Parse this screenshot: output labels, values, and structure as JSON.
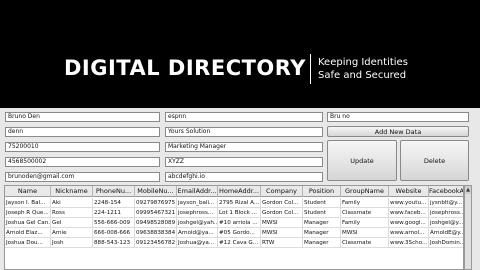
{
  "header": {
    "title": "DIGITAL DIRECTORY",
    "tagline_line1": "Keeping Identities",
    "tagline_line2": "Safe and Secured"
  },
  "form": {
    "name": "Bruno Den",
    "nickname": "denn",
    "phone": "75200010",
    "mobile": "4568500002",
    "email": "brunoden@gmail.com",
    "home_address": "espnn",
    "company": "Yours Solution",
    "position": "Marketing Manager",
    "group": "XYZZ",
    "website": "abcdefghi.io",
    "facebook": "Bru no"
  },
  "buttons": {
    "add": "Add New Data",
    "update": "Update",
    "delete": "Delete"
  },
  "table": {
    "columns": [
      "Name",
      "Nickname",
      "PhoneNu...",
      "MobileNu...",
      "EmailAddr...",
      "HomeAddr...",
      "Company",
      "Position",
      "GroupName",
      "Website",
      "FacebookA..."
    ],
    "rows": [
      [
        "Jayson I. Bal...",
        "Aki",
        "2248-154",
        "09279876975",
        "jayson_bali...",
        "2795 Rizal A...",
        "Gordon Col...",
        "Student",
        "Family",
        "www.youtu...",
        "jysnblt@y..."
      ],
      [
        "Joseph R Que...",
        "Ross",
        "224-1211",
        "09995467321",
        "josephross...",
        "Lot 1 Block ...",
        "Gordon Col...",
        "Student",
        "Classmate",
        "www.faceb...",
        "josephross..."
      ],
      [
        "Joshua Gel Can...",
        "Gel",
        "556-666-009",
        "09498528089",
        "joshgel@yah...",
        "#10 arriola ...",
        "MWSI",
        "Manager",
        "Family",
        "www.googl...",
        "joshgel@y..."
      ],
      [
        "Arnold Elaz...",
        "Arnie",
        "666-008-666",
        "09638838384",
        "Arnold@ya...",
        "#05 Gordo...",
        "MWSI",
        "Manager",
        "MWSI",
        "www.arnol...",
        "ArnoldE@y..."
      ],
      [
        "Joshua Dou...",
        "Josh",
        "888-543-123",
        "09123456782",
        "Joshua@ya...",
        "#12 Cava G...",
        "RTW",
        "Manager",
        "Classmate",
        "www.3Scho...",
        "JoshDomin..."
      ]
    ]
  }
}
